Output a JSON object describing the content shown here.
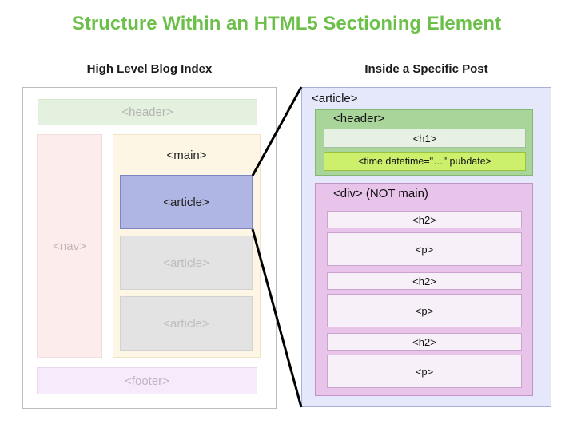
{
  "title": "Structure Within an HTML5 Sectioning Element",
  "left_panel": {
    "subtitle": "High Level Blog Index",
    "header": "<header>",
    "nav": "<nav>",
    "main": "<main>",
    "articles": [
      "<article>",
      "<article>",
      "<article>"
    ],
    "footer": "<footer>"
  },
  "right_panel": {
    "subtitle": "Inside a Specific Post",
    "article": "<article>",
    "header": "<header>",
    "h1": "<h1>",
    "time": "<time datetime=\"…\" pubdate>",
    "div": "<div> (NOT main)",
    "items": [
      "<h2>",
      "<p>",
      "<h2>",
      "<p>",
      "<h2>",
      "<p>"
    ]
  },
  "colors": {
    "title": "#6cc04a",
    "highlighted_article": "#b0b6e3",
    "header_green": "#a9d49a",
    "time_lime": "#ccef6c",
    "div_purple": "#e8c4ea",
    "article_blue_bg": "#e5e8fb"
  }
}
